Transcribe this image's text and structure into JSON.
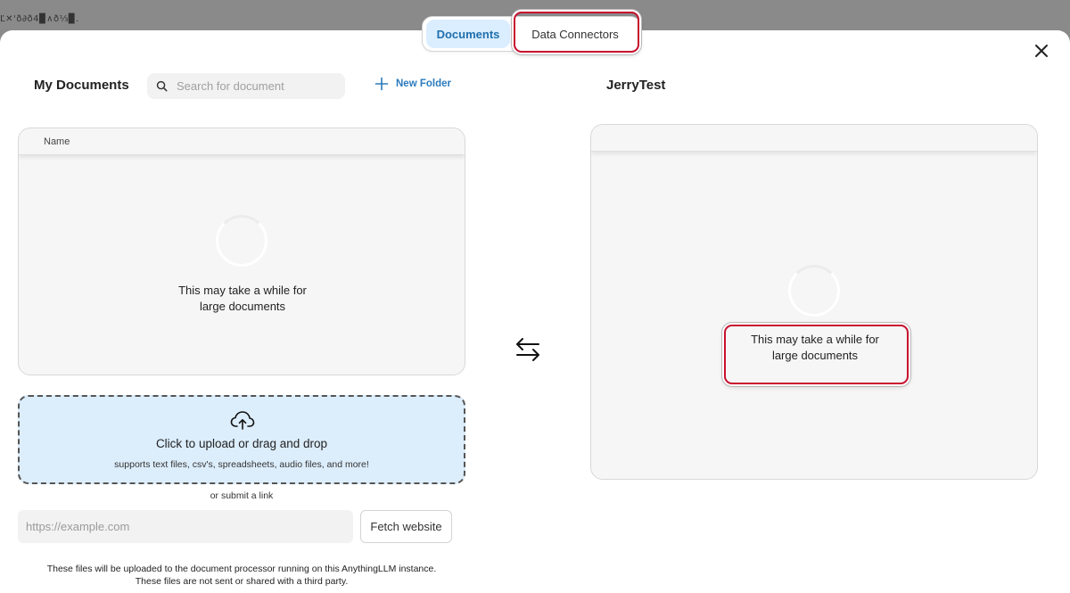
{
  "background": {
    "text": "Ľ✕'ð∂ð4▉∧ð⅓▉."
  },
  "tabs": [
    {
      "label": "Documents",
      "active": true
    },
    {
      "label": "Data Connectors",
      "active": false
    }
  ],
  "close": {
    "icon": "close-icon"
  },
  "my_documents": {
    "title": "My Documents",
    "search_placeholder": "Search for document",
    "new_folder_label": "New Folder",
    "table_header": "Name",
    "loading_line1": "This may take a while for",
    "loading_line2": "large documents"
  },
  "workspace": {
    "title": "JerryTest",
    "loading_line1": "This may take a while for",
    "loading_line2": "large documents"
  },
  "upload": {
    "title": "Click to upload or drag and drop",
    "subtitle": "supports text files, csv's, spreadsheets, audio files, and more!",
    "or_link": "or submit a link",
    "url_placeholder": "https://example.com",
    "fetch_label": "Fetch website",
    "footnote_line1": "These files will be uploaded to the document processor running on this AnythingLLM instance.",
    "footnote_line2": "These files are not sent or shared with a third party."
  },
  "colors": {
    "accent": "#2b7bbd",
    "active_tab_bg": "#dbeeff",
    "highlight": "#c8102e",
    "dropzone_bg": "#dcedfb"
  }
}
